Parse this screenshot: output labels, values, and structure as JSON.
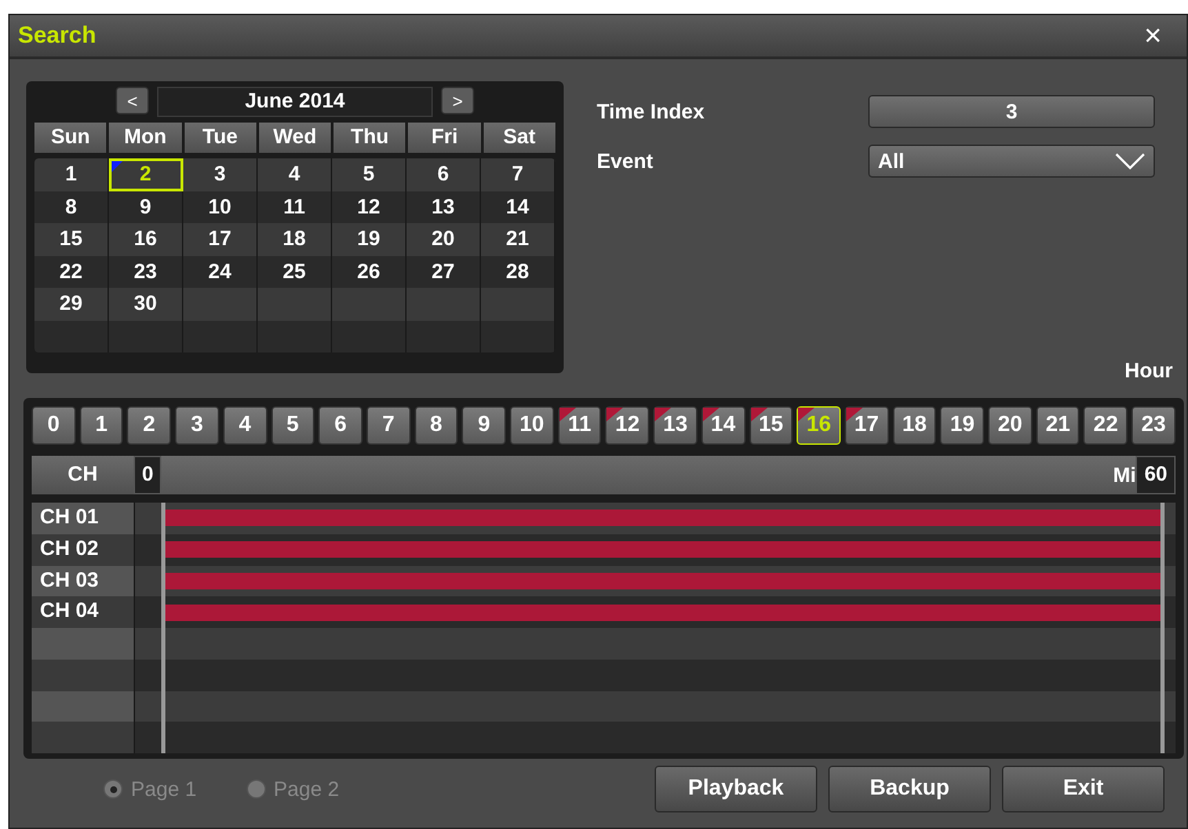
{
  "window": {
    "title": "Search",
    "close": "×"
  },
  "calendar": {
    "month": "June 2014",
    "prev": "<",
    "next": ">",
    "weekdays": [
      "Sun",
      "Mon",
      "Tue",
      "Wed",
      "Thu",
      "Fri",
      "Sat"
    ],
    "weeks": [
      [
        {
          "day": "1",
          "selected": false,
          "has_event": false
        },
        {
          "day": "2",
          "selected": true,
          "has_event": true
        },
        {
          "day": "3",
          "selected": false,
          "has_event": false
        },
        {
          "day": "4",
          "selected": false,
          "has_event": false
        },
        {
          "day": "5",
          "selected": false,
          "has_event": false
        },
        {
          "day": "6",
          "selected": false,
          "has_event": false
        },
        {
          "day": "7",
          "selected": false,
          "has_event": false
        }
      ],
      [
        {
          "day": "8",
          "selected": false,
          "has_event": false
        },
        {
          "day": "9",
          "selected": false,
          "has_event": false
        },
        {
          "day": "10",
          "selected": false,
          "has_event": false
        },
        {
          "day": "11",
          "selected": false,
          "has_event": false
        },
        {
          "day": "12",
          "selected": false,
          "has_event": false
        },
        {
          "day": "13",
          "selected": false,
          "has_event": false
        },
        {
          "day": "14",
          "selected": false,
          "has_event": false
        }
      ],
      [
        {
          "day": "15",
          "selected": false,
          "has_event": false
        },
        {
          "day": "16",
          "selected": false,
          "has_event": false
        },
        {
          "day": "17",
          "selected": false,
          "has_event": false
        },
        {
          "day": "18",
          "selected": false,
          "has_event": false
        },
        {
          "day": "19",
          "selected": false,
          "has_event": false
        },
        {
          "day": "20",
          "selected": false,
          "has_event": false
        },
        {
          "day": "21",
          "selected": false,
          "has_event": false
        }
      ],
      [
        {
          "day": "22",
          "selected": false,
          "has_event": false
        },
        {
          "day": "23",
          "selected": false,
          "has_event": false
        },
        {
          "day": "24",
          "selected": false,
          "has_event": false
        },
        {
          "day": "25",
          "selected": false,
          "has_event": false
        },
        {
          "day": "26",
          "selected": false,
          "has_event": false
        },
        {
          "day": "27",
          "selected": false,
          "has_event": false
        },
        {
          "day": "28",
          "selected": false,
          "has_event": false
        }
      ],
      [
        {
          "day": "29",
          "selected": false,
          "has_event": false
        },
        {
          "day": "30",
          "selected": false,
          "has_event": false
        }
      ]
    ]
  },
  "settings": [
    {
      "label": "Time Index",
      "kind": "button",
      "value": "3"
    },
    {
      "label": "Event",
      "kind": "dropdown",
      "value": "All"
    }
  ],
  "hours": {
    "label": "Hour",
    "items": [
      {
        "label": "0",
        "selected": false,
        "has_record": false
      },
      {
        "label": "1",
        "selected": false,
        "has_record": false
      },
      {
        "label": "2",
        "selected": false,
        "has_record": false
      },
      {
        "label": "3",
        "selected": false,
        "has_record": false
      },
      {
        "label": "4",
        "selected": false,
        "has_record": false
      },
      {
        "label": "5",
        "selected": false,
        "has_record": false
      },
      {
        "label": "6",
        "selected": false,
        "has_record": false
      },
      {
        "label": "7",
        "selected": false,
        "has_record": false
      },
      {
        "label": "8",
        "selected": false,
        "has_record": false
      },
      {
        "label": "9",
        "selected": false,
        "has_record": false
      },
      {
        "label": "10",
        "selected": false,
        "has_record": false
      },
      {
        "label": "11",
        "selected": false,
        "has_record": true
      },
      {
        "label": "12",
        "selected": false,
        "has_record": true
      },
      {
        "label": "13",
        "selected": false,
        "has_record": true
      },
      {
        "label": "14",
        "selected": false,
        "has_record": true
      },
      {
        "label": "15",
        "selected": false,
        "has_record": true
      },
      {
        "label": "16",
        "selected": true,
        "has_record": true
      },
      {
        "label": "17",
        "selected": false,
        "has_record": true
      },
      {
        "label": "18",
        "selected": false,
        "has_record": false
      },
      {
        "label": "19",
        "selected": false,
        "has_record": false
      },
      {
        "label": "20",
        "selected": false,
        "has_record": false
      },
      {
        "label": "21",
        "selected": false,
        "has_record": false
      },
      {
        "label": "22",
        "selected": false,
        "has_record": false
      },
      {
        "label": "23",
        "selected": false,
        "has_record": false
      }
    ]
  },
  "timeline": {
    "column_label": "CH",
    "start_marker": "0",
    "unit": "Mi",
    "end_marker": "60",
    "channels": [
      {
        "name": "CH 01",
        "recorded": true
      },
      {
        "name": "CH 02",
        "recorded": true
      },
      {
        "name": "CH 03",
        "recorded": true
      },
      {
        "name": "CH 04",
        "recorded": true
      }
    ]
  },
  "pages": [
    {
      "label": "Page 1",
      "selected": true
    },
    {
      "label": "Page 2",
      "selected": false
    }
  ],
  "buttons": [
    "Playback",
    "Backup",
    "Exit"
  ]
}
